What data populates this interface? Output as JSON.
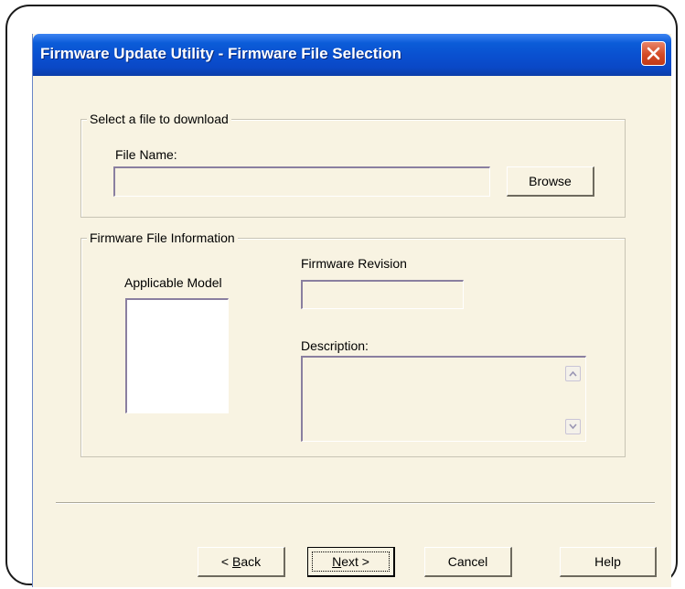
{
  "window": {
    "title": "Firmware Update Utility - Firmware File Selection"
  },
  "select_group": {
    "legend": "Select a file to download",
    "file_name_label": "File Name:",
    "file_name_value": "",
    "browse_label": "Browse"
  },
  "info_group": {
    "legend": "Firmware File Information",
    "model_label": "Applicable Model",
    "revision_label": "Firmware Revision",
    "revision_value": "",
    "description_label": "Description:",
    "description_value": ""
  },
  "buttons": {
    "back_prefix": "< ",
    "back_mnemonic": "B",
    "back_rest": "ack",
    "next_mnemonic": "N",
    "next_rest": "ext >",
    "cancel": "Cancel",
    "help": "Help"
  },
  "colors": {
    "title_bar": "#0a4fcf",
    "dialog_bg": "#f8f3e2",
    "close_button": "#d44a25"
  }
}
